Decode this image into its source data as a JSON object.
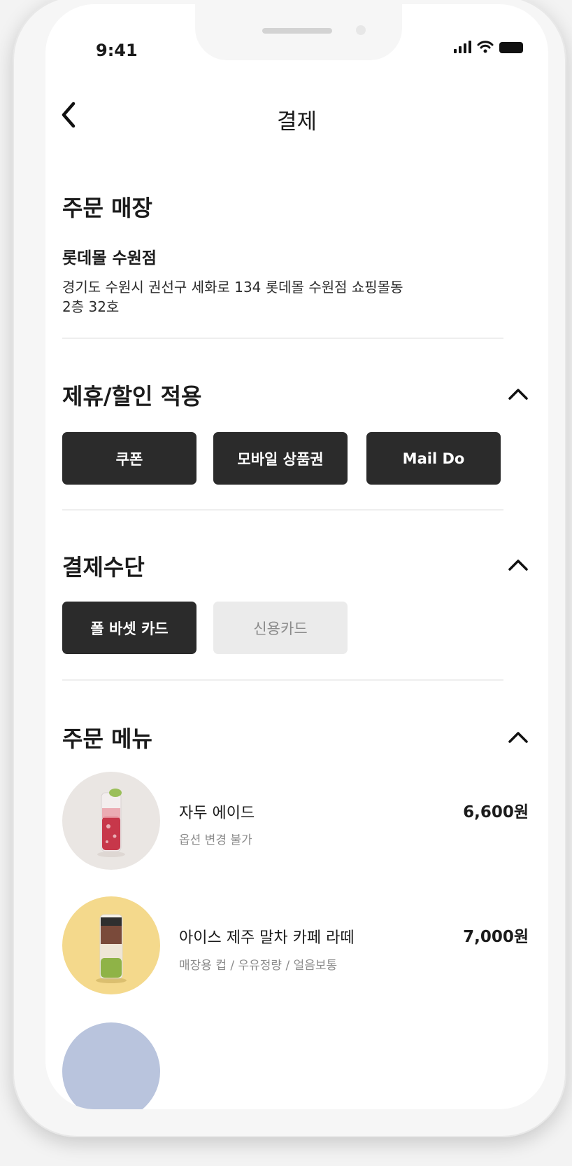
{
  "status_bar": {
    "time": "9:41"
  },
  "header": {
    "title": "결제",
    "back_icon": "chevron-left-icon"
  },
  "store_section": {
    "title": "주문 매장",
    "store_name": "롯데몰 수원점",
    "address_line1": "경기도 수원시 권선구 세화로 134 롯데몰 수원점 쇼핑몰동",
    "address_line2": "2층 32호"
  },
  "discount_section": {
    "title": "제휴/할인 적용",
    "buttons": [
      "쿠폰",
      "모바일 상품권",
      "Mail Do"
    ]
  },
  "payment_section": {
    "title": "결제수단",
    "options": [
      {
        "label": "폴 바셋 카드",
        "selected": true
      },
      {
        "label": "신용카드",
        "selected": false
      }
    ]
  },
  "order_section": {
    "title": "주문 메뉴",
    "items": [
      {
        "name": "자두 에이드",
        "options": "옵션 변경 불가",
        "price": "6,600원"
      },
      {
        "name": "아이스 제주 말차 카페 라떼",
        "options": "매장용 컵 / 우유정량 / 얼음보통",
        "price": "7,000원"
      }
    ]
  },
  "colors": {
    "dark_button": "#2b2b2b",
    "disabled_button": "#ebebeb",
    "divider": "#eeeeee"
  }
}
